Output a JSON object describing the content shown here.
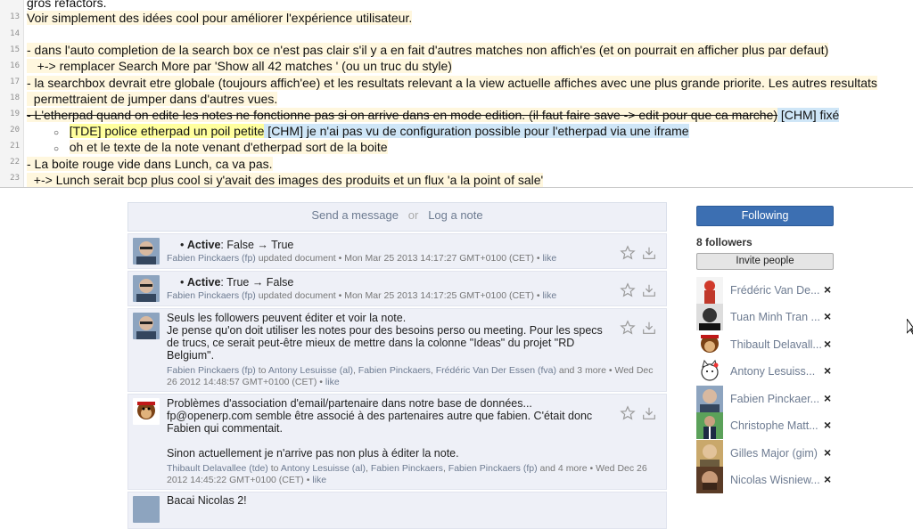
{
  "pad_lines": [
    {
      "num": "",
      "text": "gros refactors.",
      "cls": ""
    },
    {
      "num": "13",
      "text": "Voir simplement des idées cool pour améliorer l'expérience utilisateur.",
      "cls": "y"
    },
    {
      "num": "14",
      "text": "",
      "cls": ""
    },
    {
      "num": "15",
      "text": "- dans l'auto completion de la search box ce n'est pas clair s'il y a en fait d'autres matches non affich'es (et on pourrait en afficher plus par defaut)",
      "cls": "y"
    },
    {
      "num": "16",
      "text": "   +-> remplacer Search More par 'Show all 42 matches ' (ou un truc du style)",
      "cls": "y"
    },
    {
      "num": "17",
      "text": "- la searchbox devrait etre globale (toujours affich'ee) et les resultats relevant a la view actuelle affiches avec une plus grande priorite. Les autres resultats",
      "cls": "y"
    },
    {
      "num": "18",
      "text": "  permettraient de jumper dans d'autres vues.",
      "cls": "y"
    }
  ],
  "line19": {
    "num": "19",
    "strike": "- L'etherpad quand on edite les notes ne fonctionne pas si on arrive dans en mode edition. (il faut faire save -> edit pour que ca marche)",
    "tail": " [CHM] fixé"
  },
  "line20": {
    "num": "20",
    "a": "[TDE] police etherpad un poil petite",
    "b": " [CHM] je n'ai pas vu de configuration possible pour l'etherpad via une iframe"
  },
  "line21": {
    "num": "21",
    "text": "oh et le texte de la note venant d'etherpad sort de la boite"
  },
  "line22": {
    "num": "22",
    "text": "- La boite rouge vide dans Lunch, ca va pas."
  },
  "line23": {
    "num": "23",
    "text": "  +-> Lunch serait bcp plus cool si y'avait des images des produits et un flux 'a la point of sale'"
  },
  "composer": {
    "send": "Send a message",
    "or": "or",
    "log": "Log a note"
  },
  "messages": [
    {
      "field": "Active",
      "change": ": False → True",
      "author": "Fabien Pinckaers (fp)",
      "action": " updated document",
      "date": " • Mon Mar 25 2013 14:17:27 GMT+0100 (CET) • ",
      "like": "like"
    },
    {
      "field": "Active",
      "change": ": True → False",
      "author": "Fabien Pinckaers (fp)",
      "action": " updated document",
      "date": " • Mon Mar 25 2013 14:17:25 GMT+0100 (CET) • ",
      "like": "like"
    }
  ],
  "msg3": {
    "text": "Seuls les followers peuvent éditer et voir la note.\nJe pense qu'on doit utiliser les notes pour des besoins perso ou meeting. Pour les specs de trucs, ce serait peut-être mieux de mettre dans la colonne \"Ideas\" du projet \"RD Belgium\".",
    "author": "Fabien Pinckaers (fp)",
    "to": " to ",
    "r1": "Antony Lesuisse (al)",
    "r2": "Fabien Pinckaers",
    "r3": "Frédéric Van Der Essen (fva)",
    "more": " and 3 more • Wed Dec 26 2012 14:48:57 GMT+0100 (CET) • ",
    "like": "like"
  },
  "msg4": {
    "text": "Problèmes d'association d'email/partenaire dans notre base de données...\nfp@openerp.com semble être associé à des partenaires autre que fabien. C'était donc Fabien qui commentait.\n\nSinon actuellement je n'arrive pas non plus à éditer la note.",
    "author": "Thibault Delavallee (tde)",
    "to": " to ",
    "r1": "Antony Lesuisse (al)",
    "r2": "Fabien Pinckaers",
    "r3": "Fabien Pinckaers (fp)",
    "more": " and 4 more • Wed Dec 26 2012 14:45:22 GMT+0100 (CET) • ",
    "like": "like"
  },
  "msg5": {
    "text": "Bacai Nicolas 2!"
  },
  "sidebar": {
    "following": "Following",
    "followers_count": "8 followers",
    "invite": "Invite people",
    "followers": [
      {
        "name": "Frédéric Van De...",
        "avatar": "red-figure"
      },
      {
        "name": "Tuan Minh Tran ...",
        "avatar": "bw-photo"
      },
      {
        "name": "Thibault Delavall...",
        "avatar": "monkey"
      },
      {
        "name": "Antony Lesuiss...",
        "avatar": "cat"
      },
      {
        "name": "Fabien Pinckaer...",
        "avatar": "photo"
      },
      {
        "name": "Christophe Matt...",
        "avatar": "suit-photo"
      },
      {
        "name": "Gilles Major (gim)",
        "avatar": "photo"
      },
      {
        "name": "Nicolas Wisniew...",
        "avatar": "photo"
      }
    ],
    "remove": "×"
  }
}
